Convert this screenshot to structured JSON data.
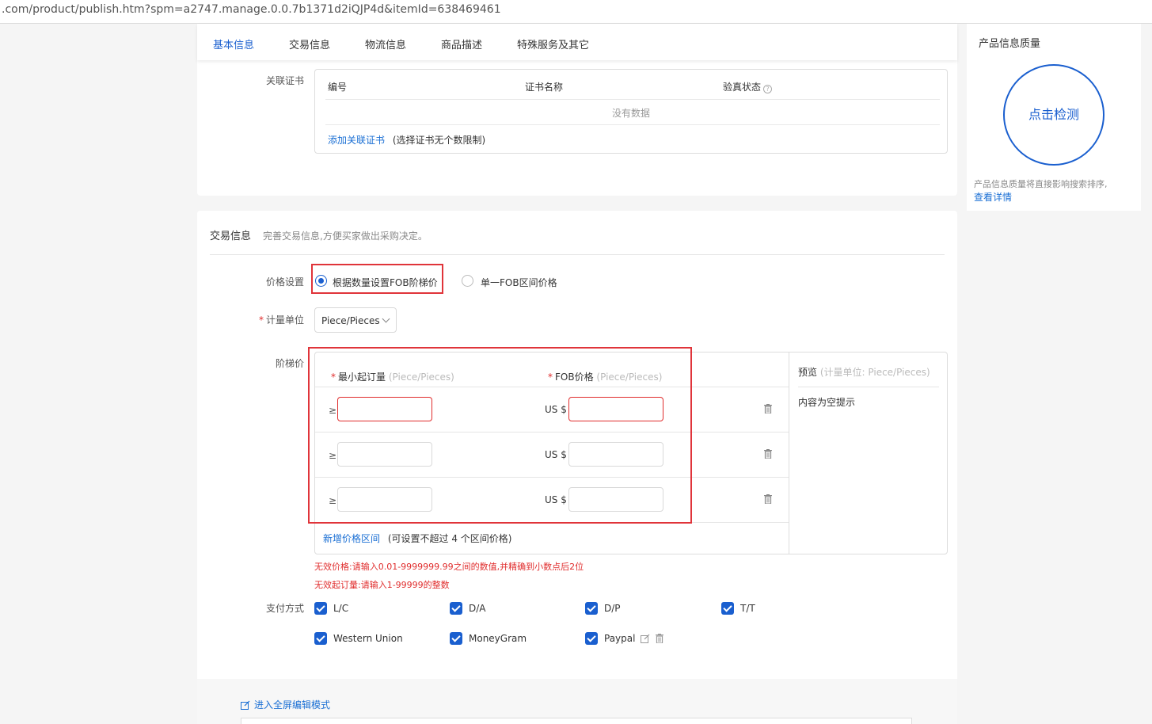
{
  "browser": {
    "url": ".com/product/publish.htm?spm=a2747.manage.0.0.7b1371d2iQJP4d&itemId=638469461"
  },
  "tabs": [
    "基本信息",
    "交易信息",
    "物流信息",
    "商品描述",
    "特殊服务及其它"
  ],
  "certificates": {
    "label": "关联证书",
    "columns": [
      "编号",
      "证书名称",
      "验真状态"
    ],
    "help_glyph": "?",
    "empty_text": "没有数据",
    "add_link": "添加关联证书",
    "add_note": "(选择证书无个数限制)"
  },
  "quality_panel": {
    "title": "产品信息质量",
    "check_button": "点击检测",
    "note": "产品信息质量将直接影响搜索排序,",
    "details_link": "查看详情"
  },
  "trade": {
    "title": "交易信息",
    "subtitle": "完善交易信息,方便买家做出采购决定。",
    "price_setting_label": "价格设置",
    "price_options": [
      "根据数量设置FOB阶梯价",
      "单一FOB区间价格"
    ],
    "selected_price_option": 0,
    "unit_label": "计量单位",
    "unit_value": "Piece/Pieces",
    "required_mark": "*",
    "tier_label": "阶梯价",
    "tier": {
      "min_order_header": "最小起订量",
      "fob_header": "FOB价格",
      "unit_hint": "(Piece/Pieces)",
      "ge_symbol": "≥",
      "currency": "US $",
      "rows": [
        {
          "min_qty": "",
          "price": "",
          "error": true
        },
        {
          "min_qty": "",
          "price": "",
          "error": false
        },
        {
          "min_qty": "",
          "price": "",
          "error": false
        }
      ],
      "add_link": "新增价格区间",
      "add_note": "(可设置不超过 4 个区间价格)"
    },
    "preview": {
      "title": "预览",
      "unit_hint": "(计量单位: Piece/Pieces)",
      "empty_text": "内容为空提示"
    },
    "errors": [
      "无效价格:请输入0.01-9999999.99之间的数值,并精确到小数点后2位",
      "无效起订量:请输入1-99999的整数"
    ],
    "payment_label": "支付方式",
    "payment_methods": [
      {
        "label": "L/C",
        "checked": true
      },
      {
        "label": "D/A",
        "checked": true
      },
      {
        "label": "D/P",
        "checked": true
      },
      {
        "label": "T/T",
        "checked": true
      },
      {
        "label": "Western Union",
        "checked": true
      },
      {
        "label": "MoneyGram",
        "checked": true
      },
      {
        "label": "Paypal",
        "checked": true
      }
    ]
  },
  "editor": {
    "fullscreen_link": "进入全屏编辑模式"
  },
  "colors": {
    "accent": "#1a5fcf",
    "error": "#e02d2d",
    "highlight_box": "#e0343a"
  }
}
